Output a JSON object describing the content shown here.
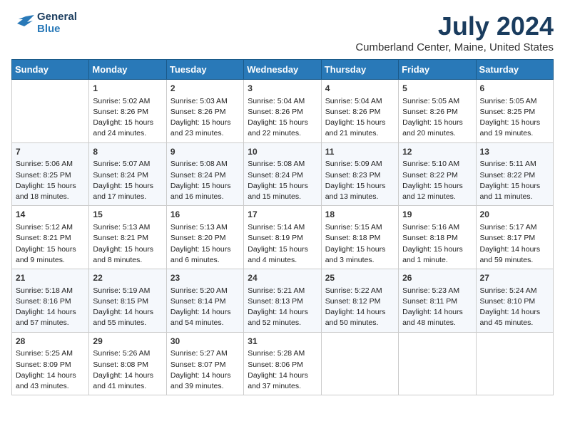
{
  "logo": {
    "line1": "General",
    "line2": "Blue"
  },
  "title": "July 2024",
  "subtitle": "Cumberland Center, Maine, United States",
  "days_header": [
    "Sunday",
    "Monday",
    "Tuesday",
    "Wednesday",
    "Thursday",
    "Friday",
    "Saturday"
  ],
  "weeks": [
    [
      {
        "num": "",
        "info": ""
      },
      {
        "num": "1",
        "info": "Sunrise: 5:02 AM\nSunset: 8:26 PM\nDaylight: 15 hours\nand 24 minutes."
      },
      {
        "num": "2",
        "info": "Sunrise: 5:03 AM\nSunset: 8:26 PM\nDaylight: 15 hours\nand 23 minutes."
      },
      {
        "num": "3",
        "info": "Sunrise: 5:04 AM\nSunset: 8:26 PM\nDaylight: 15 hours\nand 22 minutes."
      },
      {
        "num": "4",
        "info": "Sunrise: 5:04 AM\nSunset: 8:26 PM\nDaylight: 15 hours\nand 21 minutes."
      },
      {
        "num": "5",
        "info": "Sunrise: 5:05 AM\nSunset: 8:26 PM\nDaylight: 15 hours\nand 20 minutes."
      },
      {
        "num": "6",
        "info": "Sunrise: 5:05 AM\nSunset: 8:25 PM\nDaylight: 15 hours\nand 19 minutes."
      }
    ],
    [
      {
        "num": "7",
        "info": "Sunrise: 5:06 AM\nSunset: 8:25 PM\nDaylight: 15 hours\nand 18 minutes."
      },
      {
        "num": "8",
        "info": "Sunrise: 5:07 AM\nSunset: 8:24 PM\nDaylight: 15 hours\nand 17 minutes."
      },
      {
        "num": "9",
        "info": "Sunrise: 5:08 AM\nSunset: 8:24 PM\nDaylight: 15 hours\nand 16 minutes."
      },
      {
        "num": "10",
        "info": "Sunrise: 5:08 AM\nSunset: 8:24 PM\nDaylight: 15 hours\nand 15 minutes."
      },
      {
        "num": "11",
        "info": "Sunrise: 5:09 AM\nSunset: 8:23 PM\nDaylight: 15 hours\nand 13 minutes."
      },
      {
        "num": "12",
        "info": "Sunrise: 5:10 AM\nSunset: 8:22 PM\nDaylight: 15 hours\nand 12 minutes."
      },
      {
        "num": "13",
        "info": "Sunrise: 5:11 AM\nSunset: 8:22 PM\nDaylight: 15 hours\nand 11 minutes."
      }
    ],
    [
      {
        "num": "14",
        "info": "Sunrise: 5:12 AM\nSunset: 8:21 PM\nDaylight: 15 hours\nand 9 minutes."
      },
      {
        "num": "15",
        "info": "Sunrise: 5:13 AM\nSunset: 8:21 PM\nDaylight: 15 hours\nand 8 minutes."
      },
      {
        "num": "16",
        "info": "Sunrise: 5:13 AM\nSunset: 8:20 PM\nDaylight: 15 hours\nand 6 minutes."
      },
      {
        "num": "17",
        "info": "Sunrise: 5:14 AM\nSunset: 8:19 PM\nDaylight: 15 hours\nand 4 minutes."
      },
      {
        "num": "18",
        "info": "Sunrise: 5:15 AM\nSunset: 8:18 PM\nDaylight: 15 hours\nand 3 minutes."
      },
      {
        "num": "19",
        "info": "Sunrise: 5:16 AM\nSunset: 8:18 PM\nDaylight: 15 hours\nand 1 minute."
      },
      {
        "num": "20",
        "info": "Sunrise: 5:17 AM\nSunset: 8:17 PM\nDaylight: 14 hours\nand 59 minutes."
      }
    ],
    [
      {
        "num": "21",
        "info": "Sunrise: 5:18 AM\nSunset: 8:16 PM\nDaylight: 14 hours\nand 57 minutes."
      },
      {
        "num": "22",
        "info": "Sunrise: 5:19 AM\nSunset: 8:15 PM\nDaylight: 14 hours\nand 55 minutes."
      },
      {
        "num": "23",
        "info": "Sunrise: 5:20 AM\nSunset: 8:14 PM\nDaylight: 14 hours\nand 54 minutes."
      },
      {
        "num": "24",
        "info": "Sunrise: 5:21 AM\nSunset: 8:13 PM\nDaylight: 14 hours\nand 52 minutes."
      },
      {
        "num": "25",
        "info": "Sunrise: 5:22 AM\nSunset: 8:12 PM\nDaylight: 14 hours\nand 50 minutes."
      },
      {
        "num": "26",
        "info": "Sunrise: 5:23 AM\nSunset: 8:11 PM\nDaylight: 14 hours\nand 48 minutes."
      },
      {
        "num": "27",
        "info": "Sunrise: 5:24 AM\nSunset: 8:10 PM\nDaylight: 14 hours\nand 45 minutes."
      }
    ],
    [
      {
        "num": "28",
        "info": "Sunrise: 5:25 AM\nSunset: 8:09 PM\nDaylight: 14 hours\nand 43 minutes."
      },
      {
        "num": "29",
        "info": "Sunrise: 5:26 AM\nSunset: 8:08 PM\nDaylight: 14 hours\nand 41 minutes."
      },
      {
        "num": "30",
        "info": "Sunrise: 5:27 AM\nSunset: 8:07 PM\nDaylight: 14 hours\nand 39 minutes."
      },
      {
        "num": "31",
        "info": "Sunrise: 5:28 AM\nSunset: 8:06 PM\nDaylight: 14 hours\nand 37 minutes."
      },
      {
        "num": "",
        "info": ""
      },
      {
        "num": "",
        "info": ""
      },
      {
        "num": "",
        "info": ""
      }
    ]
  ]
}
